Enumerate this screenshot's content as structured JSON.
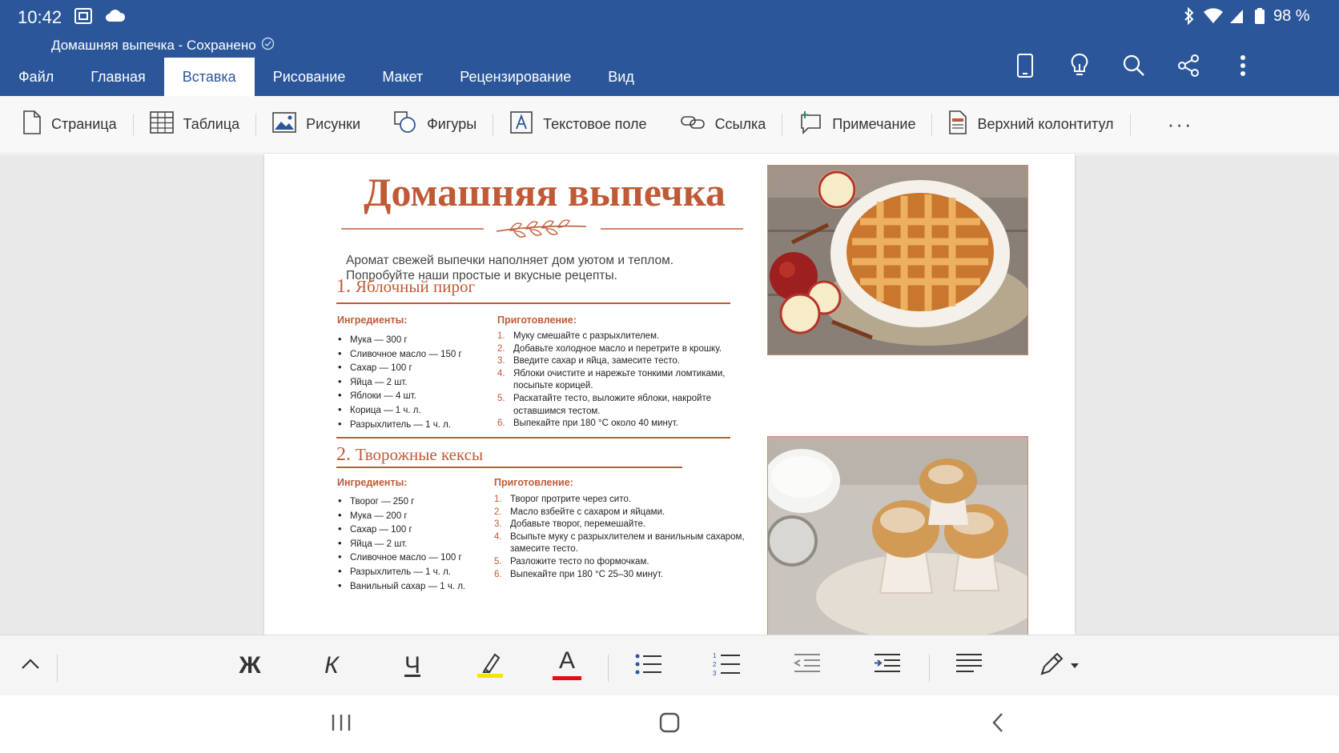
{
  "status_bar": {
    "time": "10:42",
    "battery": "98 %",
    "left_icons": [
      "screenshot-icon",
      "cloud-icon"
    ],
    "right_icons": [
      "bluetooth-icon",
      "wifi-icon",
      "signal-icon",
      "battery-icon"
    ]
  },
  "document_title": "Домашняя выпечка - Сохранено",
  "tabs": [
    {
      "label": "Файл",
      "active": false
    },
    {
      "label": "Главная",
      "active": false
    },
    {
      "label": "Вставка",
      "active": true
    },
    {
      "label": "Рисование",
      "active": false
    },
    {
      "label": "Макет",
      "active": false
    },
    {
      "label": "Рецензирование",
      "active": false
    },
    {
      "label": "Вид",
      "active": false
    }
  ],
  "header_actions": [
    "phone-view-icon",
    "lightbulb-icon",
    "search-icon",
    "share-icon",
    "more-vertical-icon"
  ],
  "ribbon": {
    "items": [
      {
        "label": "Страница",
        "icon": "page-icon"
      },
      {
        "label": "Таблица",
        "icon": "table-icon"
      },
      {
        "label": "Рисунки",
        "icon": "picture-icon"
      },
      {
        "label": "Фигуры",
        "icon": "shapes-icon"
      },
      {
        "label": "Текстовое поле",
        "icon": "textbox-icon"
      },
      {
        "label": "Ссылка",
        "icon": "link-icon"
      },
      {
        "label": "Примечание",
        "icon": "comment-icon"
      },
      {
        "label": "Верхний колонтитул",
        "icon": "header-icon"
      }
    ],
    "more": "···"
  },
  "document": {
    "title": "Домашняя выпечка",
    "intro_line1": "Аромат свежей выпечки наполняет дом уютом и теплом.",
    "intro_line2": "Попробуйте наши простые и вкусные рецепты.",
    "recipes": [
      {
        "number": "1.",
        "title": "Яблочный пирог",
        "ingredients_label": "Ингредиенты:",
        "steps_label": "Приготовление:",
        "ingredients": [
          "Мука — 300 г",
          "Сливочное масло — 150 г",
          "Сахар — 100 г",
          "Яйца — 2 шт.",
          "Яблоки — 4 шт.",
          "Корица — 1 ч. л.",
          "Разрыхлитель — 1 ч. л."
        ],
        "steps": [
          {
            "n": "1.",
            "lines": [
              "Муку смешайте с разрыхлителем."
            ]
          },
          {
            "n": "2.",
            "lines": [
              "Добавьте холодное масло и перетрите в крошку."
            ]
          },
          {
            "n": "3.",
            "lines": [
              "Введите сахар и яйца, замесите тесто."
            ]
          },
          {
            "n": "4.",
            "lines": [
              "Яблоки очистите и нарежьте тонкими ломтиками,",
              "посыпьте корицей."
            ]
          },
          {
            "n": "5.",
            "lines": [
              "Раскатайте тесто, выложите яблоки, накройте",
              "оставшимся тестом."
            ]
          },
          {
            "n": "6.",
            "lines": [
              "Выпекайте при 180 °С около 40 минут."
            ]
          }
        ],
        "image": "apple-pie-photo"
      },
      {
        "number": "2.",
        "title": "Творожные кексы",
        "ingredients_label": "Ингредиенты:",
        "steps_label": "Приготовление:",
        "ingredients": [
          "Творог — 250 г",
          "Мука — 200 г",
          "Сахар — 100 г",
          "Яйца — 2 шт.",
          "Сливочное масло — 100 г",
          "Разрыхлитель — 1 ч. л.",
          "Ванильный сахар — 1 ч. л."
        ],
        "steps": [
          {
            "n": "1.",
            "lines": [
              "Творог протрите через сито."
            ]
          },
          {
            "n": "2.",
            "lines": [
              "Масло взбейте с сахаром и яйцами."
            ]
          },
          {
            "n": "3.",
            "lines": [
              "Добавьте творог, перемешайте."
            ]
          },
          {
            "n": "4.",
            "lines": [
              "Всыпьте муку с разрыхлителем и ванильным сахаром,",
              "замесите тесто."
            ]
          },
          {
            "n": "5.",
            "lines": [
              "Разложите тесто по формочкам."
            ]
          },
          {
            "n": "6.",
            "lines": [
              "Выпекайте при 180 °С 25–30 минут."
            ]
          }
        ],
        "image": "cupcakes-photo"
      }
    ]
  },
  "format_bar": {
    "bold": "Ж",
    "italic": "К",
    "underline": "Ч",
    "font_color": "A",
    "highlight_color": "#f5e400",
    "font_color_value": "#e01010"
  },
  "colors": {
    "word_blue": "#2b579a",
    "heading_accent": "#c05a36"
  }
}
